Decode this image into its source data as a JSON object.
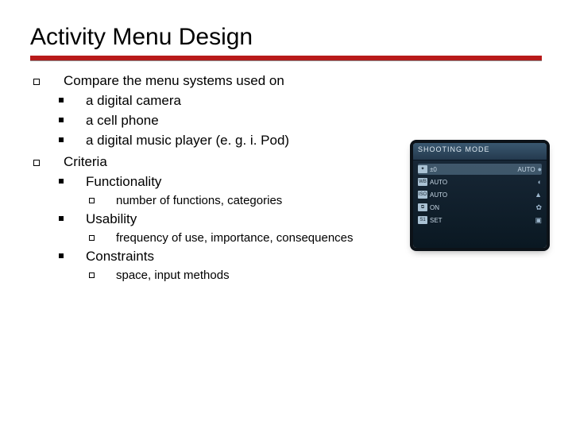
{
  "title": "Activity Menu Design",
  "outline": {
    "p1": {
      "text": "Compare the menu systems used on",
      "sub": {
        "a": "a digital camera",
        "b": "a cell phone",
        "c": "a digital music player (e. g. i. Pod)"
      }
    },
    "p2": {
      "text": "Criteria",
      "sub": {
        "a": {
          "text": "Functionality",
          "detail": "number of functions, categories"
        },
        "b": {
          "text": "Usability",
          "detail": "frequency of use, importance, consequences"
        },
        "c": {
          "text": "Constraints",
          "detail": "space, input methods"
        }
      }
    }
  },
  "camera": {
    "header": "SHOOTING MODE",
    "rows": [
      {
        "left_icon": "✦",
        "left": "±0",
        "right": "AUTO",
        "right_icon": "●",
        "selected": true
      },
      {
        "left_icon": "WB",
        "left": "AUTO",
        "right": "",
        "right_icon": "◐",
        "selected": false
      },
      {
        "left_icon": "ISO",
        "left": "AUTO",
        "right": "",
        "right_icon": "▲",
        "selected": false
      },
      {
        "left_icon": "⧉",
        "left": "ON",
        "right": "",
        "right_icon": "✿",
        "selected": false
      },
      {
        "left_icon": "S1",
        "left": "SET",
        "right": "",
        "right_icon": "▣",
        "selected": false
      }
    ]
  }
}
